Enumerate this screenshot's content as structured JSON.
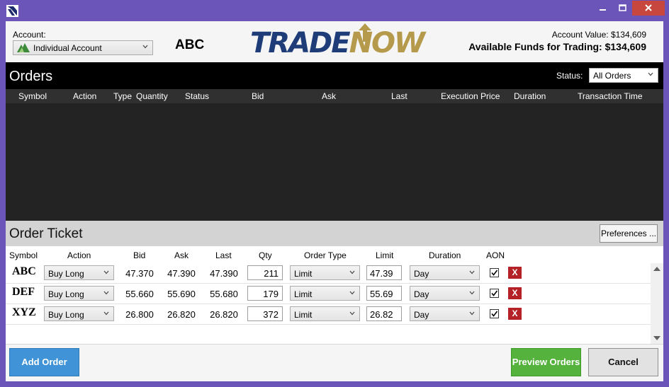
{
  "window": {
    "icons": [
      "app-icon",
      "minimize-icon",
      "maximize-icon",
      "close-icon"
    ],
    "colors": {
      "frame": "#6b55b9",
      "close": "#c7463e"
    }
  },
  "header": {
    "account_label": "Account:",
    "account_value": "Individual Account",
    "selected_symbol": "ABC",
    "logo_part1": "TRADE",
    "logo_part2": "NOW",
    "account_value_text": "Account Value: $134,609",
    "available_funds_text": "Available Funds for Trading: $134,609",
    "logo_colors": {
      "trade": "#1d3c78",
      "now": "#b59a4b"
    }
  },
  "orders": {
    "title": "Orders",
    "status_label": "Status:",
    "status_value": "All Orders",
    "columns": [
      "Symbol",
      "Action",
      "Type",
      "Quantity",
      "Status",
      "Bid",
      "Ask",
      "Last",
      "Execution Price",
      "Duration",
      "Transaction Time"
    ],
    "rows": []
  },
  "ticket": {
    "title": "Order Ticket",
    "preferences_label": "Preferences ...",
    "columns": [
      "Symbol",
      "Action",
      "Bid",
      "Ask",
      "Last",
      "Qty",
      "Order Type",
      "Limit",
      "Duration",
      "AON"
    ],
    "rows": [
      {
        "symbol": "ABC",
        "action": "Buy Long",
        "bid": "47.370",
        "ask": "47.390",
        "last": "47.390",
        "qty": "211",
        "order_type": "Limit",
        "limit": "47.39",
        "duration": "Day",
        "aon": true,
        "delete": "X"
      },
      {
        "symbol": "DEF",
        "action": "Buy Long",
        "bid": "55.660",
        "ask": "55.690",
        "last": "55.680",
        "qty": "179",
        "order_type": "Limit",
        "limit": "55.69",
        "duration": "Day",
        "aon": true,
        "delete": "X"
      },
      {
        "symbol": "XYZ",
        "action": "Buy Long",
        "bid": "26.800",
        "ask": "26.820",
        "last": "26.820",
        "qty": "372",
        "order_type": "Limit",
        "limit": "26.82",
        "duration": "Day",
        "aon": true,
        "delete": "X"
      }
    ]
  },
  "footer": {
    "add_order": "Add Order",
    "preview_orders": "Preview Orders",
    "cancel": "Cancel",
    "colors": {
      "add": "#3f93d6",
      "preview": "#55b33d"
    }
  }
}
